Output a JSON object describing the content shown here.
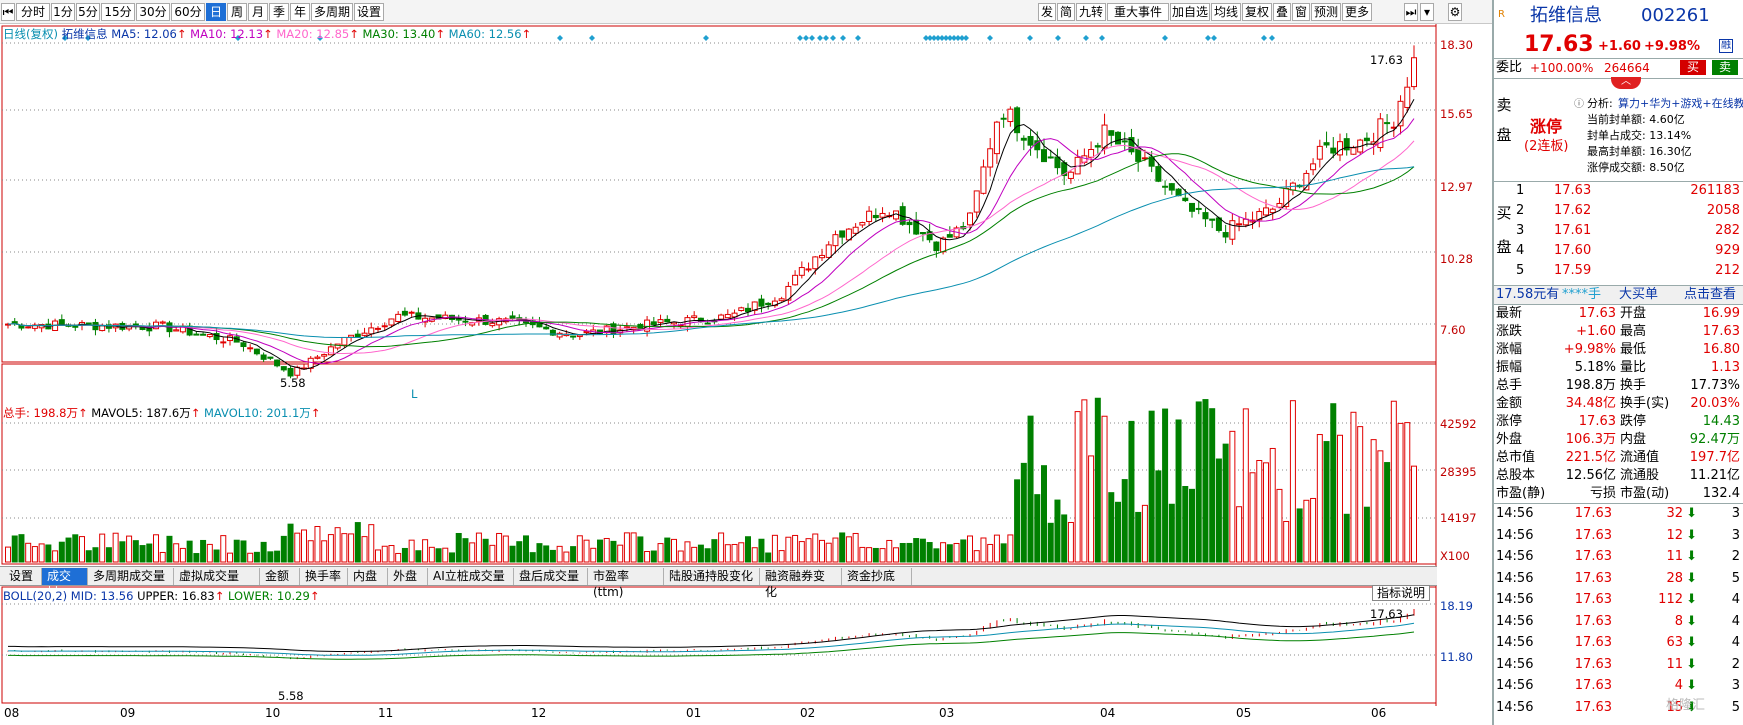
{
  "toolbar": {
    "left": [
      "分时",
      "1分",
      "5分",
      "15分",
      "30分",
      "60分",
      "日",
      "周",
      "月",
      "季",
      "年",
      "多周期",
      "设置"
    ],
    "right": [
      "发",
      "简",
      "九转",
      "重大事件",
      "加自选",
      "均线",
      "复权",
      "叠",
      "窗",
      "预测",
      "更多"
    ],
    "active": "日"
  },
  "chart": {
    "ma_legend": {
      "name": "日线(复权)",
      "stock": "拓维信息",
      "ma5": "MA5: 12.06",
      "ma10": "MA10: 12.13",
      "ma20": "MA20: 12.85",
      "ma30": "MA30: 13.40",
      "ma60": "MA60: 12.56"
    },
    "price_axis": [
      "18.30",
      "15.65",
      "12.97",
      "10.28",
      "7.60"
    ],
    "high_label": "17.63",
    "low_label": "5.58",
    "marker_L": "L",
    "vol_legend": {
      "total": "总手: 198.8万",
      "mavol5": "MAVOL5: 187.6万",
      "mavol10": "MAVOL10: 201.1万"
    },
    "vol_axis": [
      "42592",
      "28395",
      "14197"
    ],
    "vol_unit": "X100",
    "boll_legend": {
      "boll": "BOLL(20,2) MID: 13.56",
      "upper": "UPPER: 16.83",
      "lower": "LOWER: 10.29"
    },
    "boll_axis": [
      "18.19",
      "11.80"
    ],
    "boll_high": "17.63",
    "boll_low": "5.58",
    "indicator_btn": "指标说明",
    "months": [
      "08",
      "09",
      "10",
      "11",
      "12",
      "01",
      "02",
      "03",
      "04",
      "05",
      "06"
    ],
    "colors": {
      "up": "#e00000",
      "down": "#008000",
      "ma5": "#000000",
      "ma10": "#c000c0",
      "ma20": "#ff66cc",
      "ma30": "#008000",
      "ma60": "#0a8fb0"
    }
  },
  "tabs": [
    "设置",
    "成交量",
    "多周期成交量",
    "虚拟成交量",
    "金额",
    "换手率",
    "内盘",
    "外盘",
    "AI立桩成交量",
    "盘后成交量",
    "市盈率(ttm)",
    "陆股通持股变化",
    "融资融券变化",
    "资金抄底"
  ],
  "active_tab": "成交量",
  "quote": {
    "name": "拓维信息",
    "code": "002261",
    "price": "17.63",
    "change": "+1.60",
    "pct": "+9.98%",
    "badge": "融",
    "weibi_label": "委比",
    "weibi": "+100.00%",
    "weicha": "264664",
    "buy": "买",
    "sell": "卖",
    "sell_label": "卖盘",
    "limit": "涨停",
    "limit_sub": "(2连板)",
    "analysis": {
      "label": "分析:",
      "tags": "算力+华为+游戏+在线教",
      "l1": "当前封单额: 4.60亿",
      "l2": "封单占成交: 13.14%",
      "l3": "最高封单额: 16.30亿",
      "l4": "涨停成交额: 8.50亿"
    },
    "buy_label": "买盘",
    "bids": [
      {
        "lv": "1",
        "p": "17.63",
        "v": "261183"
      },
      {
        "lv": "2",
        "p": "17.62",
        "v": "2058"
      },
      {
        "lv": "3",
        "p": "17.61",
        "v": "282"
      },
      {
        "lv": "4",
        "p": "17.60",
        "v": "929"
      },
      {
        "lv": "5",
        "p": "17.59",
        "v": "212"
      }
    ],
    "bigorder": {
      "a": "17.58元有",
      "b": "****手",
      "c": "大买单",
      "d": "点击查看"
    },
    "stats": [
      [
        "最新",
        "17.63",
        "开盘",
        "16.99"
      ],
      [
        "涨跌",
        "+1.60",
        "最高",
        "17.63"
      ],
      [
        "涨幅",
        "+9.98%",
        "最低",
        "16.80"
      ],
      [
        "振幅",
        "5.18%",
        "量比",
        "1.13"
      ],
      [
        "总手",
        "198.8万",
        "换手",
        "17.73%"
      ],
      [
        "金额",
        "34.48亿",
        "换手(实)",
        "20.03%"
      ],
      [
        "涨停",
        "17.63",
        "跌停",
        "14.43"
      ],
      [
        "外盘",
        "106.3万",
        "内盘",
        "92.47万"
      ],
      [
        "总市值",
        "221.5亿",
        "流通值",
        "197.7亿"
      ],
      [
        "总股本",
        "12.56亿",
        "流通股",
        "11.21亿"
      ],
      [
        "市盈(静)",
        "亏损",
        "市盈(动)",
        "132.4"
      ]
    ],
    "ticks": [
      [
        "14:56",
        "17.63",
        "32",
        "3"
      ],
      [
        "14:56",
        "17.63",
        "12",
        "3"
      ],
      [
        "14:56",
        "17.63",
        "11",
        "2"
      ],
      [
        "14:56",
        "17.63",
        "28",
        "5"
      ],
      [
        "14:56",
        "17.63",
        "112",
        "4"
      ],
      [
        "14:56",
        "17.63",
        "8",
        "4"
      ],
      [
        "14:56",
        "17.63",
        "63",
        "4"
      ],
      [
        "14:56",
        "17.63",
        "11",
        "2"
      ],
      [
        "14:56",
        "17.63",
        "4",
        "3"
      ],
      [
        "14:56",
        "17.63",
        "15",
        "5"
      ]
    ],
    "watermark": "格隆汇"
  }
}
